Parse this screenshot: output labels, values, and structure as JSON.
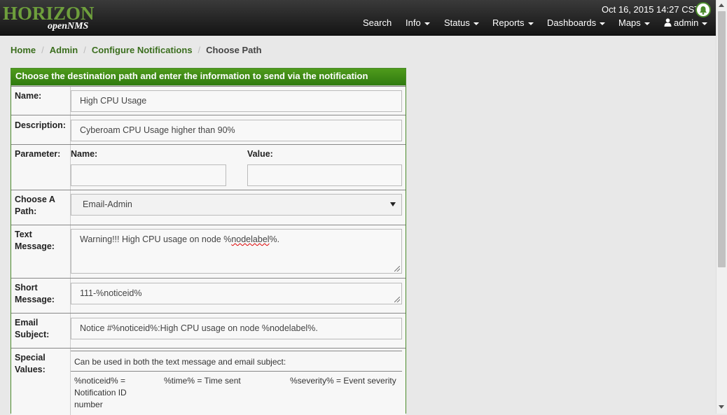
{
  "header": {
    "logo_main": "HORIZON",
    "logo_sub": "openNMS",
    "datetime": "Oct 16, 2015 14:27 CST",
    "nav": [
      {
        "label": "Search",
        "caret": false
      },
      {
        "label": "Info",
        "caret": true
      },
      {
        "label": "Status",
        "caret": true
      },
      {
        "label": "Reports",
        "caret": true
      },
      {
        "label": "Dashboards",
        "caret": true
      },
      {
        "label": "Maps",
        "caret": true
      },
      {
        "label": "admin",
        "caret": true
      }
    ]
  },
  "breadcrumb": {
    "home": "Home",
    "admin": "Admin",
    "configure": "Configure Notifications",
    "current": "Choose Path"
  },
  "panel": {
    "title": "Choose the destination path and enter the information to send via the notification",
    "name_label": "Name:",
    "name_value": "High CPU Usage",
    "description_label": "Description:",
    "description_value": "Cyberoam CPU Usage higher than 90%",
    "parameter_label": "Parameter:",
    "param_name_label": "Name:",
    "param_value_label": "Value:",
    "param_name_value": "",
    "param_value_value": "",
    "path_label_1": "Choose A",
    "path_label_2": "Path:",
    "path_value": "Email-Admin",
    "text_label_1": "Text",
    "text_label_2": "Message:",
    "text_value_pre": "Warning!!! High CPU usage on node %",
    "text_value_spell": "nodelabel",
    "text_value_post": "%.",
    "short_label_1": "Short",
    "short_label_2": "Message:",
    "short_value": "111-%noticeid%",
    "email_label_1": "Email",
    "email_label_2": "Subject:",
    "email_value": "Notice #%noticeid%:High CPU usage on node %nodelabel%.",
    "special_label_1": "Special",
    "special_label_2": "Values:",
    "special_intro": "Can be used in both the text message and email subject:",
    "special_1_a": "%noticeid% =",
    "special_1_b": "Notification ID",
    "special_1_c": "number",
    "special_2": "%time% = Time sent",
    "special_3": "%severity% = Event severity"
  }
}
